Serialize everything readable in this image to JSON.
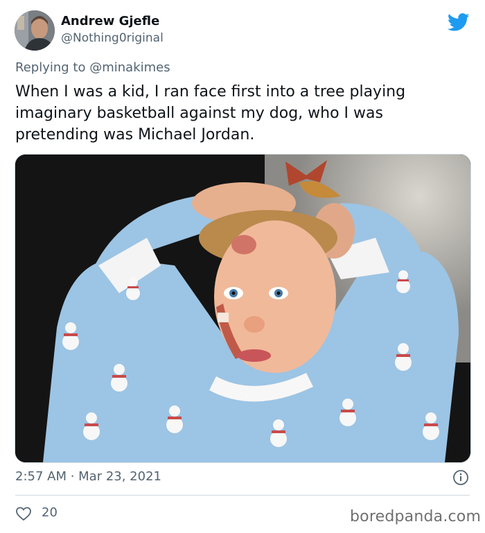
{
  "tweet": {
    "author_name": "Andrew Gjefle",
    "author_handle": "@Nothing0riginal",
    "reply_prefix": "Replying to",
    "reply_mention": "@minakimes",
    "text": "When I was a kid, I ran face first into a tree playing imaginary basketball against my dog, who I was pretending was Michael Jordan.",
    "timestamp": "2:57 AM · Mar 23, 2021",
    "like_count": "20"
  },
  "icons": {
    "brand": "twitter-bird-icon",
    "info": "info-icon",
    "like": "heart-icon"
  },
  "colors": {
    "twitter_blue": "#1d9bf0",
    "secondary_text": "#536471",
    "primary_text": "#0f1419"
  },
  "watermark": "boredpanda.com"
}
